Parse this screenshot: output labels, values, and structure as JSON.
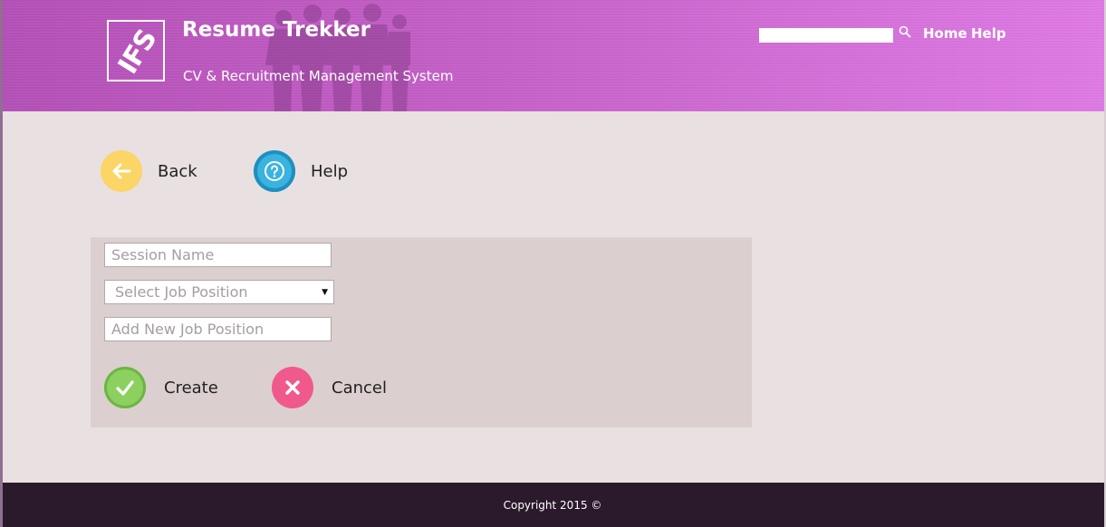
{
  "header": {
    "logo_text": "IFS",
    "title": "Resume Trekker",
    "subtitle": "CV & Recruitment Management System",
    "search": {
      "value": "",
      "placeholder": ""
    },
    "nav": {
      "home": "Home",
      "help": "Help"
    }
  },
  "actions": {
    "back_label": "Back",
    "help_label": "Help"
  },
  "form": {
    "session_name": {
      "value": "",
      "placeholder": "Session Name"
    },
    "job_position_select": {
      "selected": "Select Job Position"
    },
    "new_job_position": {
      "value": "",
      "placeholder": "Add New Job Position"
    },
    "create_label": "Create",
    "cancel_label": "Cancel"
  },
  "footer": {
    "copyright": "Copyright 2015 ©"
  },
  "colors": {
    "header_start": "#b24fb5",
    "header_end": "#dc78e2",
    "back_icon": "#fbd566",
    "help_icon": "#39b3e0",
    "create_icon": "#8cd160",
    "cancel_icon": "#f0598c",
    "page_bg": "#e9e0e1",
    "panel_bg": "#dccfcf",
    "footer_bg": "#2b1a2b"
  },
  "icons": {
    "logo": "ifs-logo-icon",
    "search": "search-icon",
    "back": "arrow-left-icon",
    "help": "question-icon",
    "create": "checkmark-icon",
    "cancel": "close-icon",
    "select": "caret-down-icon"
  }
}
